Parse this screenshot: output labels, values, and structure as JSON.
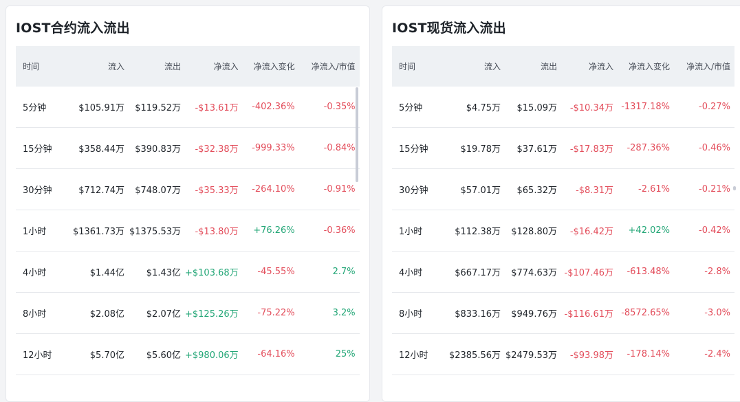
{
  "colors": {
    "negative": "#e34d5b",
    "positive": "#22a676",
    "header_bg": "#eef1f4"
  },
  "headers": [
    "时间",
    "流入",
    "流出",
    "净流入",
    "净流入变化",
    "净流入/市值"
  ],
  "contract": {
    "title": "IOST合约流入流出",
    "rows": [
      {
        "time": "5分钟",
        "inflow": "$105.91万",
        "outflow": "$119.52万",
        "net": "-$13.61万",
        "change": "-402.36%",
        "ratio": "-0.35%"
      },
      {
        "time": "15分钟",
        "inflow": "$358.44万",
        "outflow": "$390.83万",
        "net": "-$32.38万",
        "change": "-999.33%",
        "ratio": "-0.84%"
      },
      {
        "time": "30分钟",
        "inflow": "$712.74万",
        "outflow": "$748.07万",
        "net": "-$35.33万",
        "change": "-264.10%",
        "ratio": "-0.91%"
      },
      {
        "time": "1小时",
        "inflow": "$1361.73万",
        "outflow": "$1375.53万",
        "net": "-$13.80万",
        "change": "+76.26%",
        "ratio": "-0.36%"
      },
      {
        "time": "4小时",
        "inflow": "$1.44亿",
        "outflow": "$1.43亿",
        "net": "+$103.68万",
        "change": "-45.55%",
        "ratio": "2.7%"
      },
      {
        "time": "8小时",
        "inflow": "$2.08亿",
        "outflow": "$2.07亿",
        "net": "+$125.26万",
        "change": "-75.22%",
        "ratio": "3.2%"
      },
      {
        "time": "12小时",
        "inflow": "$5.70亿",
        "outflow": "$5.60亿",
        "net": "+$980.06万",
        "change": "-64.16%",
        "ratio": "25%"
      }
    ]
  },
  "spot": {
    "title": "IOST现货流入流出",
    "rows": [
      {
        "time": "5分钟",
        "inflow": "$4.75万",
        "outflow": "$15.09万",
        "net": "-$10.34万",
        "change": "-1317.18%",
        "ratio": "-0.27%"
      },
      {
        "time": "15分钟",
        "inflow": "$19.78万",
        "outflow": "$37.61万",
        "net": "-$17.83万",
        "change": "-287.36%",
        "ratio": "-0.46%"
      },
      {
        "time": "30分钟",
        "inflow": "$57.01万",
        "outflow": "$65.32万",
        "net": "-$8.31万",
        "change": "-2.61%",
        "ratio": "-0.21%"
      },
      {
        "time": "1小时",
        "inflow": "$112.38万",
        "outflow": "$128.80万",
        "net": "-$16.42万",
        "change": "+42.02%",
        "ratio": "-0.42%"
      },
      {
        "time": "4小时",
        "inflow": "$667.17万",
        "outflow": "$774.63万",
        "net": "-$107.46万",
        "change": "-613.48%",
        "ratio": "-2.8%"
      },
      {
        "time": "8小时",
        "inflow": "$833.16万",
        "outflow": "$949.76万",
        "net": "-$116.61万",
        "change": "-8572.65%",
        "ratio": "-3.0%"
      },
      {
        "time": "12小时",
        "inflow": "$2385.56万",
        "outflow": "$2479.53万",
        "net": "-$93.98万",
        "change": "-178.14%",
        "ratio": "-2.4%"
      }
    ]
  }
}
